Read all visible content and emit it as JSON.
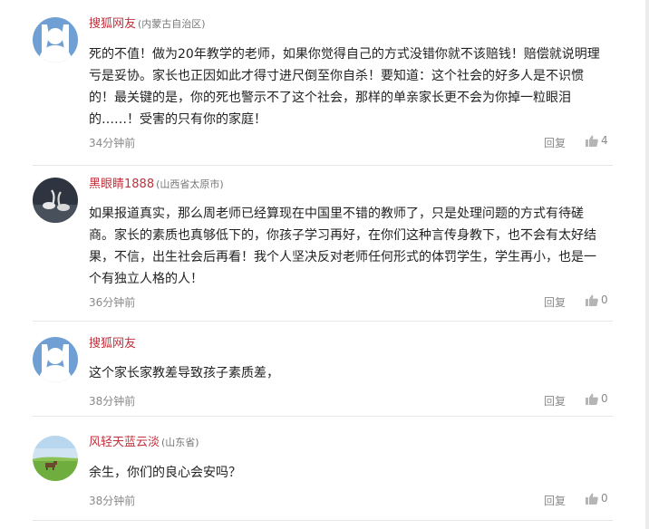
{
  "comments": [
    {
      "username": "搜狐网友",
      "location": "(内蒙古自治区)",
      "avatar_icon": "default-user-icon",
      "lines": [
        "死的不值！做为20年教学的老师，如果你觉得自己的方式没错你就不该赔钱！赔偿就说明理",
        "亏是妥协。家长也正因如此才得寸进尺倒至你自杀！要知道：这个社会的好多人是不识惯",
        "的！最关键的是，你的死也警示不了这个社会，那样的单亲家长更不会为你掉一粒眼泪",
        "的……！受害的只有你的家庭！"
      ],
      "time": "34分钟前",
      "reply_label": "回复",
      "likes": "4"
    },
    {
      "username": "黑眼睛1888",
      "location": "(山西省太原市)",
      "avatar_icon": "swans-photo",
      "lines": [
        "如果报道真实，那么周老师已经算现在中国里不错的教师了，只是处理问题的方式有待磋",
        "商。家长的素质也真够低下的，你孩子学习再好，在你们这种言传身教下，也不会有太好结",
        "果，不信，出生社会后再看！我个人坚决反对老师任何形式的体罚学生，学生再小，也是一",
        "个有独立人格的人！"
      ],
      "time": "36分钟前",
      "reply_label": "回复",
      "likes": "0"
    },
    {
      "username": "搜狐网友",
      "location": "",
      "avatar_icon": "default-user-icon",
      "lines": [
        "这个家长家教差导致孩子素质差，"
      ],
      "time": "38分钟前",
      "reply_label": "回复",
      "likes": "0"
    },
    {
      "username": "风轻天蓝云淡",
      "location": "(山东省)",
      "avatar_icon": "grassland-photo",
      "lines": [
        "余生，你们的良心会安吗？"
      ],
      "time": "38分钟前",
      "reply_label": "回复",
      "likes": "0"
    }
  ],
  "colors": {
    "username": "#c2303c",
    "meta": "#8a8a8a",
    "avatar_default": "#6f9fd3"
  }
}
